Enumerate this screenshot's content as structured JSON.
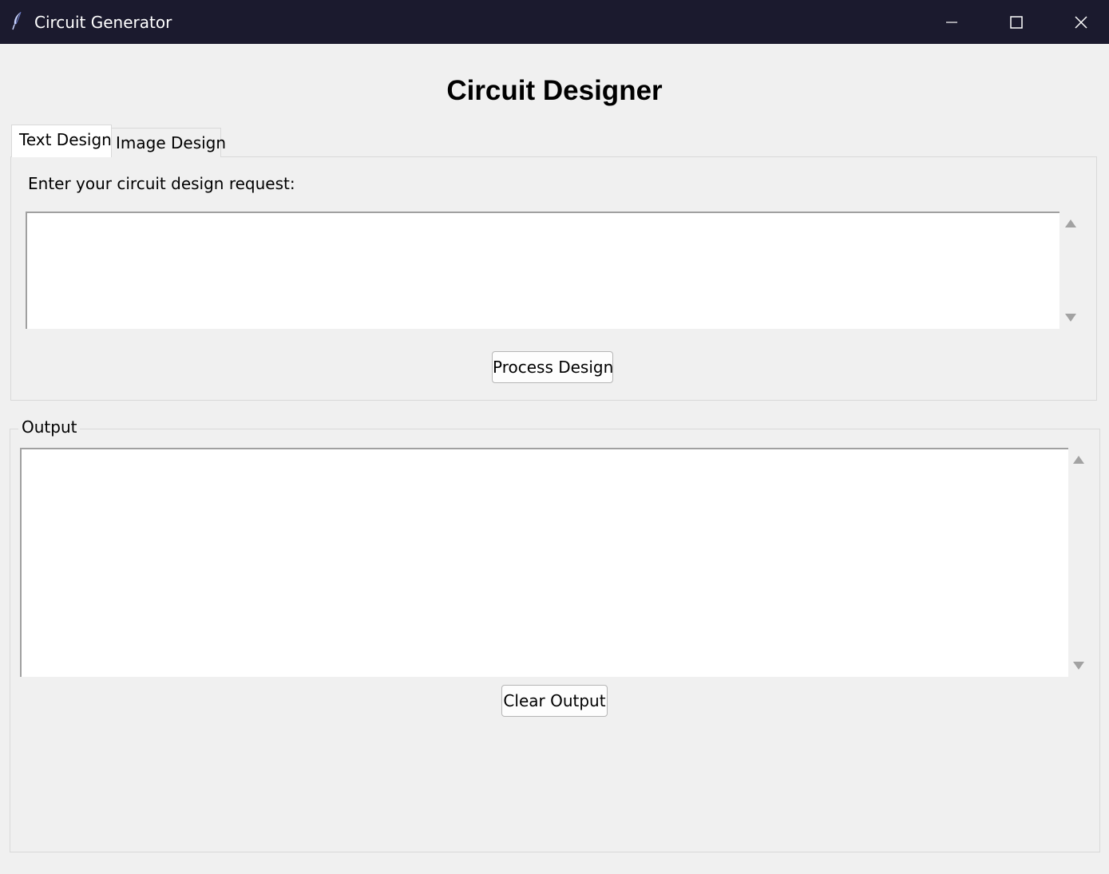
{
  "window": {
    "title": "Circuit Generator",
    "icon": "feather-icon",
    "controls": [
      "minimize-icon",
      "maximize-icon",
      "close-icon"
    ]
  },
  "heading": "Circuit Designer",
  "tabs": [
    {
      "label": "Text Design",
      "selected": true
    },
    {
      "label": "Image Design",
      "selected": false
    }
  ],
  "text_design": {
    "prompt_label": "Enter your circuit design request:",
    "input_value": "",
    "process_button": "Process Design"
  },
  "output": {
    "frame_label": "Output",
    "text_value": "",
    "clear_button": "Clear Output"
  },
  "colors": {
    "titlebar": "#1b1a2e",
    "window_bg": "#f0f0f0"
  }
}
